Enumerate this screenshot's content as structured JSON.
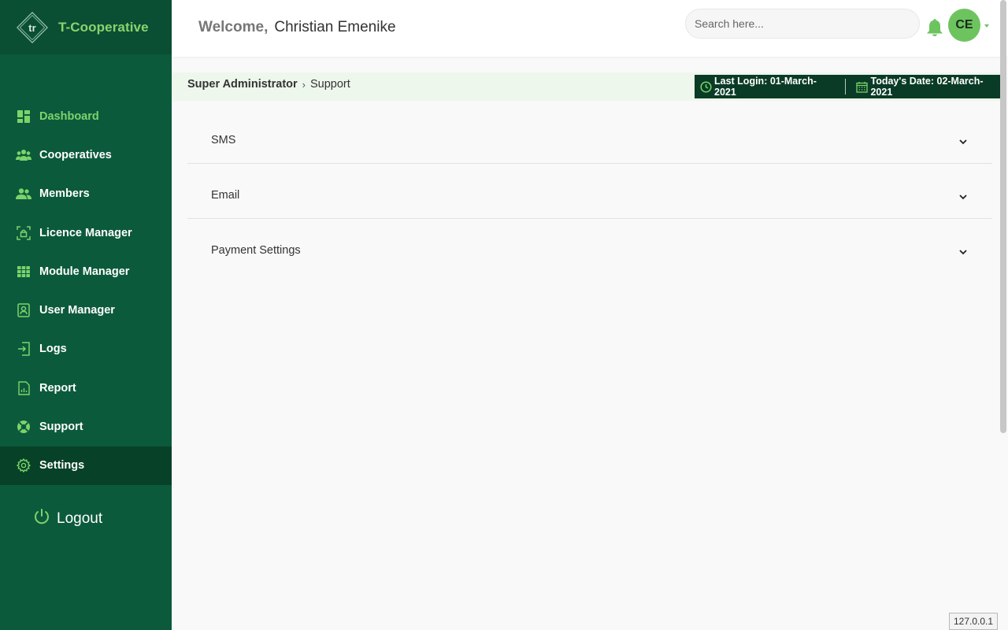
{
  "brand": {
    "name": "T-Cooperative",
    "logo_letters": "tr"
  },
  "sidebar": {
    "items": [
      {
        "label": "Dashboard",
        "icon": "dashboard-icon"
      },
      {
        "label": "Cooperatives",
        "icon": "group-icon"
      },
      {
        "label": "Members",
        "icon": "people-icon"
      },
      {
        "label": "Licence Manager",
        "icon": "licence-icon"
      },
      {
        "label": "Module Manager",
        "icon": "grid-icon"
      },
      {
        "label": "User Manager",
        "icon": "user-badge-icon"
      },
      {
        "label": "Logs",
        "icon": "login-icon"
      },
      {
        "label": "Report",
        "icon": "report-icon"
      },
      {
        "label": "Support",
        "icon": "lifebuoy-icon"
      },
      {
        "label": "Settings",
        "icon": "gear-icon"
      }
    ],
    "logout_label": "Logout"
  },
  "header": {
    "welcome_label": "Welcome,",
    "user_name": "Christian Emenike",
    "search_placeholder": "Search here...",
    "avatar_initials": "CE"
  },
  "breadcrumb": {
    "root": "Super Administrator",
    "separator": "›",
    "current": "Support"
  },
  "info": {
    "last_login": "Last Login: 01-March-2021",
    "today_date": "Today's Date: 02-March-2021"
  },
  "accordion": [
    {
      "title": "SMS"
    },
    {
      "title": "Email"
    },
    {
      "title": "Payment Settings"
    }
  ],
  "footer": {
    "host": "127.0.0.1"
  },
  "colors": {
    "sidebar": "#0c5a3c",
    "accent": "#7bd46a",
    "info_bar": "#0a3b26"
  }
}
